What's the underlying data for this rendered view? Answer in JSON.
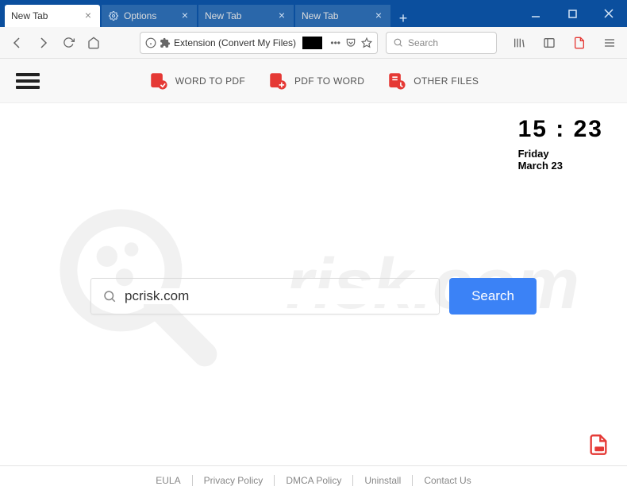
{
  "browser": {
    "tabs": [
      {
        "label": "New Tab",
        "active": true
      },
      {
        "label": "Options",
        "active": false
      },
      {
        "label": "New Tab",
        "active": false
      },
      {
        "label": "New Tab",
        "active": false
      }
    ],
    "urlbar_text": "Extension (Convert My Files)",
    "search_placeholder": "Search"
  },
  "ext_toolbar": {
    "items": [
      {
        "label": "WORD TO PDF"
      },
      {
        "label": "PDF TO WORD"
      },
      {
        "label": "OTHER FILES"
      }
    ]
  },
  "clock": {
    "time": "15 : 23",
    "day": "Friday",
    "date": "March 23"
  },
  "search": {
    "value": "pcrisk.com",
    "button": "Search"
  },
  "footer": {
    "links": [
      "EULA",
      "Privacy Policy",
      "DMCA Policy",
      "Uninstall",
      "Contact Us"
    ]
  },
  "watermark": "risk.com"
}
